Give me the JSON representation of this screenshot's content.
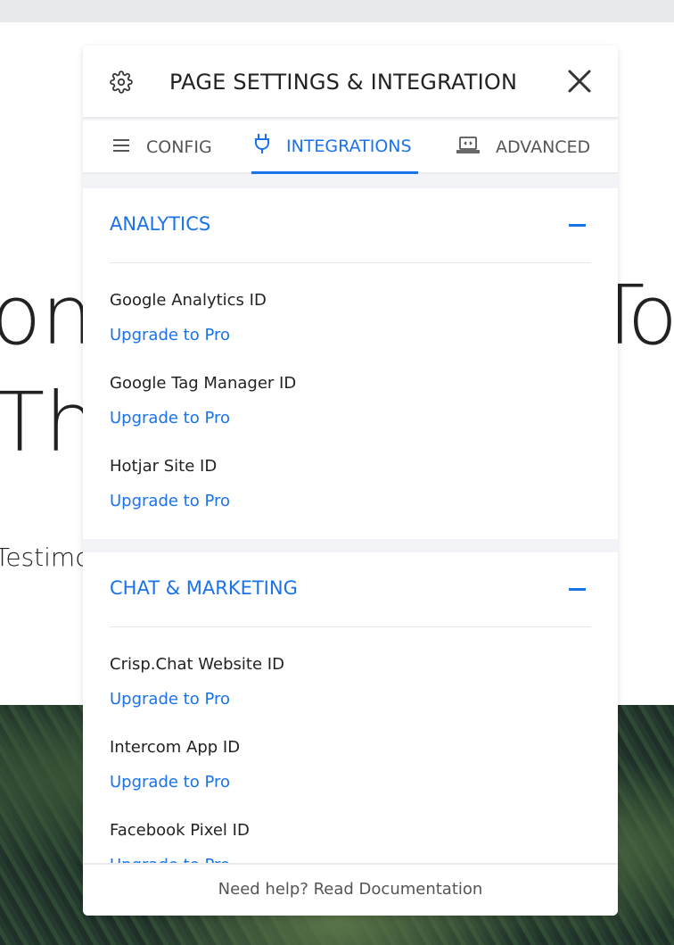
{
  "background": {
    "line1_left": "ont",
    "line1_right": "To",
    "line2": "Th",
    "line3": "Testimo"
  },
  "panel": {
    "title": "PAGE SETTINGS & INTEGRATION",
    "tabs": [
      {
        "label": "CONFIG",
        "icon": "menu-icon"
      },
      {
        "label": "INTEGRATIONS",
        "icon": "plug-icon",
        "active": true
      },
      {
        "label": "ADVANCED",
        "icon": "laptop-code-icon"
      }
    ],
    "sections": [
      {
        "title": "ANALYTICS",
        "fields": [
          {
            "label": "Google Analytics ID",
            "link": "Upgrade to Pro"
          },
          {
            "label": "Google Tag Manager ID",
            "link": "Upgrade to Pro"
          },
          {
            "label": "Hotjar Site ID",
            "link": "Upgrade to Pro"
          }
        ]
      },
      {
        "title": "CHAT & MARKETING",
        "fields": [
          {
            "label": "Crisp.Chat Website ID",
            "link": "Upgrade to Pro"
          },
          {
            "label": "Intercom App ID",
            "link": "Upgrade to Pro"
          },
          {
            "label": "Facebook Pixel ID",
            "link": "Upgrade to Pro"
          }
        ]
      }
    ],
    "footer": "Need help? Read Documentation"
  },
  "colors": {
    "accent": "#1a73e8"
  }
}
